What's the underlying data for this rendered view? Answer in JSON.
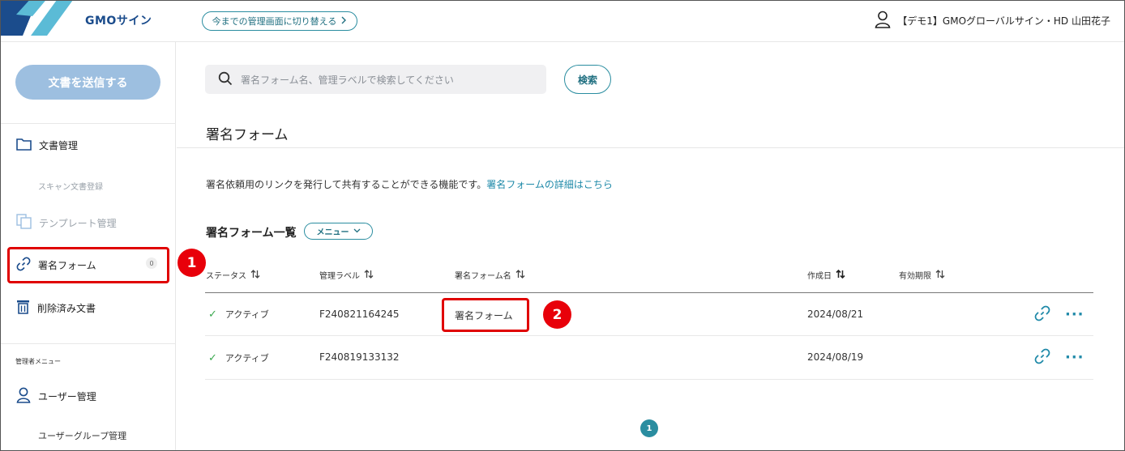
{
  "header": {
    "logo": "GMOサイン",
    "switch_label": "今までの管理画面に切り替える",
    "user_name": "【デモ1】GMOグローバルサイン・HD 山田花子"
  },
  "sidebar": {
    "send_button": "文書を送信する",
    "items": [
      {
        "label": "文書管理",
        "icon": "folder-icon"
      },
      {
        "label": "スキャン文書登録"
      },
      {
        "label": "テンプレート管理",
        "icon": "template-icon"
      },
      {
        "label": "署名フォーム",
        "icon": "link-icon",
        "badge": "0"
      },
      {
        "label": "削除済み文書",
        "icon": "trash-icon"
      }
    ],
    "admin_menu_label": "管理者メニュー",
    "admin_items": [
      {
        "label": "ユーザー管理",
        "icon": "user-icon"
      },
      {
        "label": "ユーザーグループ管理"
      }
    ]
  },
  "search": {
    "placeholder": "署名フォーム名、管理ラベルで検索してください",
    "button": "検索"
  },
  "page": {
    "title": "署名フォーム",
    "description": "署名依頼用のリンクを発行して共有することができる機能です。",
    "description_link": "署名フォームの詳細はこちら",
    "section_title": "署名フォーム一覧",
    "menu_button": "メニュー"
  },
  "table": {
    "columns": [
      "ステータス",
      "管理ラベル",
      "署名フォーム名",
      "作成日",
      "有効期限"
    ],
    "rows": [
      {
        "status": "アクティブ",
        "label": "F240821164245",
        "name": "署名フォーム",
        "created": "2024/08/21",
        "expires": ""
      },
      {
        "status": "アクティブ",
        "label": "F240819133132",
        "name": "",
        "created": "2024/08/19",
        "expires": ""
      }
    ]
  },
  "pagination": {
    "current": "1"
  },
  "annotations": [
    "1",
    "2"
  ],
  "colors": {
    "accent": "#2a8da0",
    "highlight": "#e00000",
    "send_button": "#9dbfe0"
  }
}
